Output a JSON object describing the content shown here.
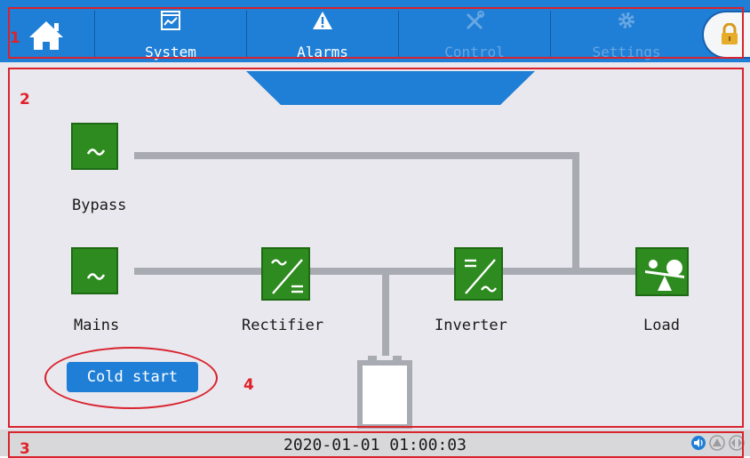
{
  "nav": {
    "tabs": [
      {
        "label": "System",
        "icon": "chart-icon",
        "enabled": true
      },
      {
        "label": "Alarms",
        "icon": "alarm-icon",
        "enabled": true
      },
      {
        "label": "Control",
        "icon": "tools-icon",
        "enabled": false
      },
      {
        "label": "Settings",
        "icon": "gear-icon",
        "enabled": false
      }
    ],
    "home_icon": "home-icon",
    "lock_icon": "lock-icon"
  },
  "markers": {
    "m1": "1",
    "m2": "2",
    "m3": "3",
    "m4": "4"
  },
  "diagram": {
    "bypass": "Bypass",
    "mains": "Mains",
    "rectifier": "Rectifier",
    "inverter": "Inverter",
    "load": "Load"
  },
  "cold_start_label": "Cold start",
  "status": {
    "datetime": "2020-01-01  01:00:03",
    "icons": [
      "sound-icon",
      "alarm-icon",
      "power-flow-icon"
    ]
  },
  "colors": {
    "accent": "#1f7fd6",
    "component": "#2e8b1f",
    "highlight": "#d9232e",
    "panel": "#e9e8ee"
  }
}
